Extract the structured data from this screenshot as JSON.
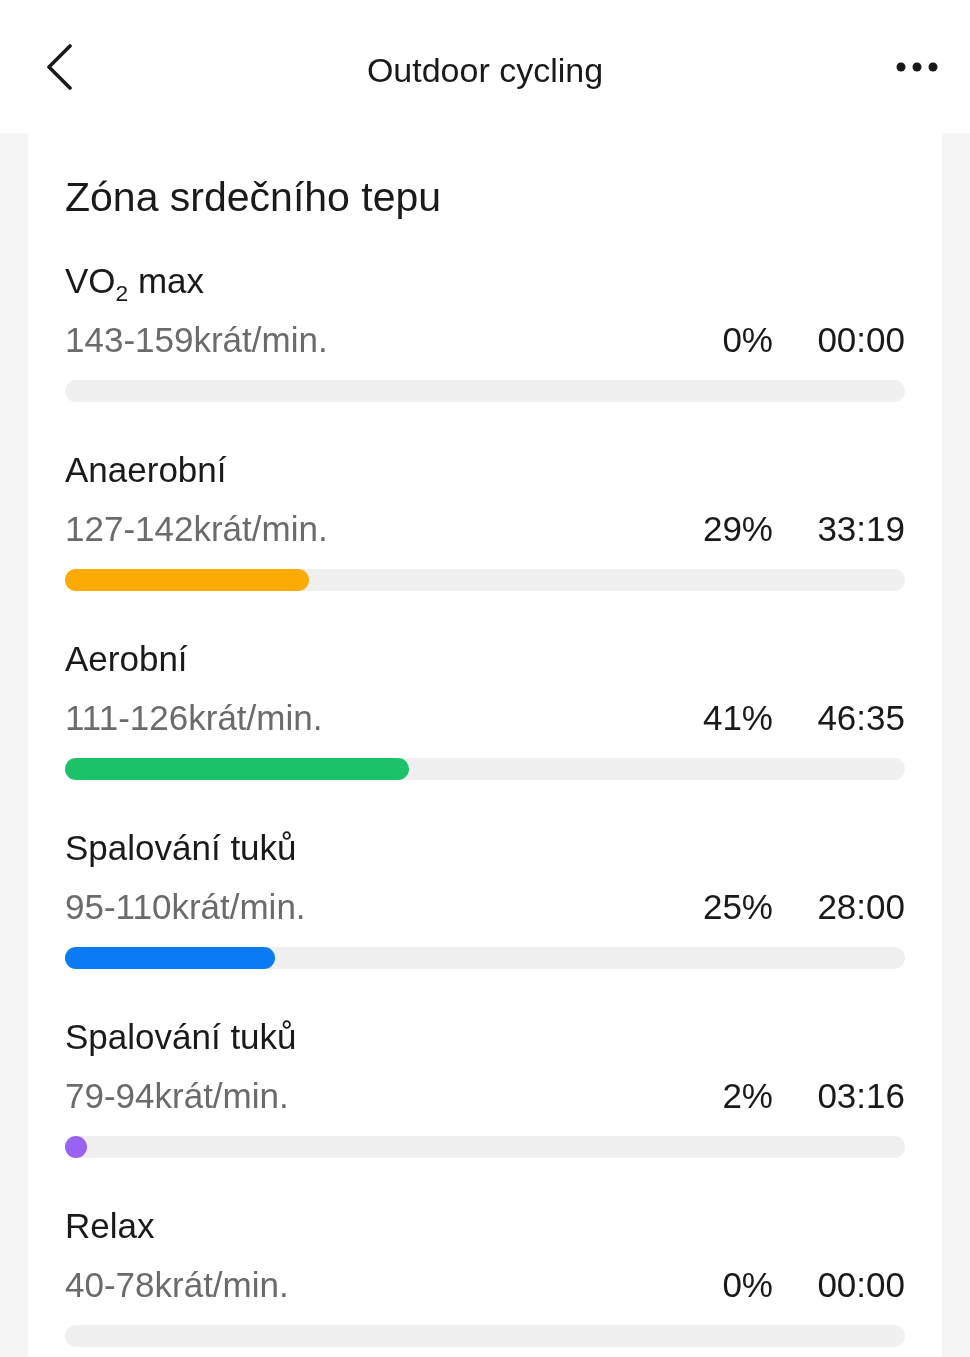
{
  "header": {
    "title": "Outdoor cycling"
  },
  "card": {
    "title": "Zóna srdečního tepu",
    "zones": [
      {
        "name": "VO$_{2}$ max",
        "range": "143-159krát/min.",
        "percent": "0%",
        "time": "00:00"
      },
      {
        "name": "Anaerobní",
        "range": "127-142krát/min.",
        "percent": "29%",
        "time": "33:19",
        "level": 0.29,
        "color": "#fbab03"
      },
      {
        "name": "Aerobní",
        "range": "111-126krát/min.",
        "percent": "41%",
        "time": "46:35",
        "level": 0.41,
        "color": "#1cc26a"
      },
      {
        "name": "Spalování tuků",
        "range": "95-110krát/min.",
        "percent": "25%",
        "time": "28:00",
        "level": 0.25,
        "color": "#0b7bf3"
      },
      {
        "name": "Spalování tuků",
        "range": "79-94krát/min.",
        "percent": "2%",
        "time": "03:16",
        "level": 0.02,
        "color": "#9a62f3"
      },
      {
        "name": "Relax",
        "range": "40-78krát/min.",
        "percent": "0%",
        "time": "00:00"
      }
    ]
  }
}
